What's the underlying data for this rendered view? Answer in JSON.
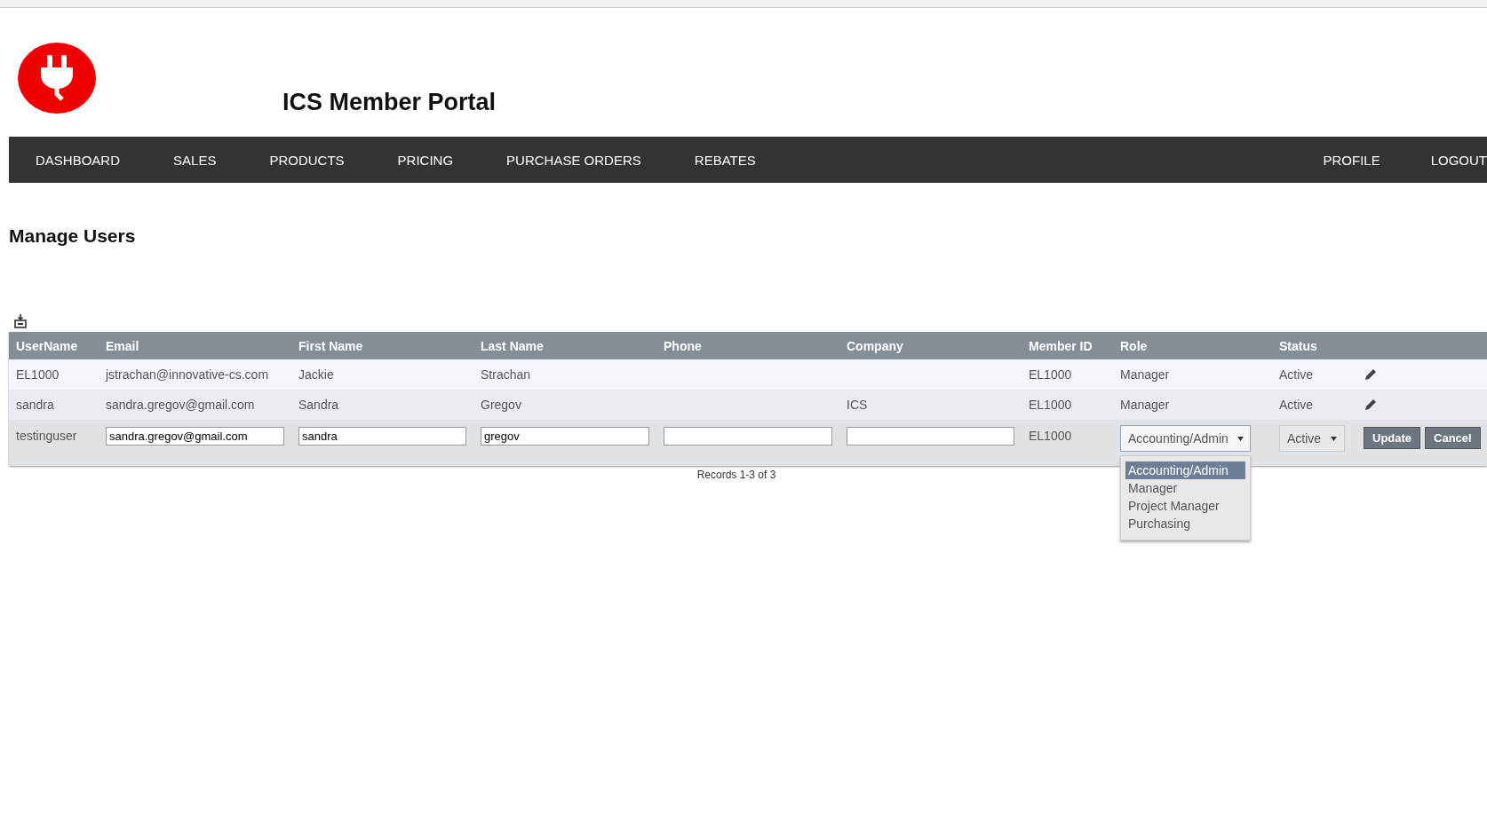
{
  "header": {
    "title": "ICS Member Portal"
  },
  "nav": {
    "left": [
      {
        "label": "DASHBOARD"
      },
      {
        "label": "SALES"
      },
      {
        "label": "PRODUCTS"
      },
      {
        "label": "PRICING"
      },
      {
        "label": "PURCHASE ORDERS"
      },
      {
        "label": "REBATES"
      }
    ],
    "right": [
      {
        "label": "PROFILE"
      },
      {
        "label": "LOGOUT"
      }
    ]
  },
  "page_title": "Manage Users",
  "table": {
    "columns": [
      "UserName",
      "Email",
      "First Name",
      "Last Name",
      "Phone",
      "Company",
      "Member ID",
      "Role",
      "Status"
    ],
    "rows": [
      {
        "kind": "view",
        "username": "EL1000",
        "email": "jstrachan@innovative-cs.com",
        "first_name": "Jackie",
        "last_name": "Strachan",
        "phone": "",
        "company": "",
        "member_id": "EL1000",
        "role": "Manager",
        "status": "Active"
      },
      {
        "kind": "view",
        "username": "sandra",
        "email": "sandra.gregov@gmail.com",
        "first_name": "Sandra",
        "last_name": "Gregov",
        "phone": "",
        "company": "ICS",
        "member_id": "EL1000",
        "role": "Manager",
        "status": "Active"
      },
      {
        "kind": "edit",
        "username": "testinguser",
        "email": "sandra.gregov@gmail.com",
        "first_name": "sandra",
        "last_name": "gregov",
        "phone": "",
        "company": "",
        "member_id": "EL1000",
        "role": "Accounting/Admin",
        "status": "Active",
        "role_expanded": true,
        "role_options": [
          {
            "label": "Accounting/Admin",
            "selected": true
          },
          {
            "label": "Manager",
            "selected": false
          },
          {
            "label": "Project Manager",
            "selected": false
          },
          {
            "label": "Purchasing",
            "selected": false
          }
        ],
        "buttons": [
          "Update",
          "Cancel"
        ]
      }
    ]
  },
  "records": "Records 1-3 of 3"
}
